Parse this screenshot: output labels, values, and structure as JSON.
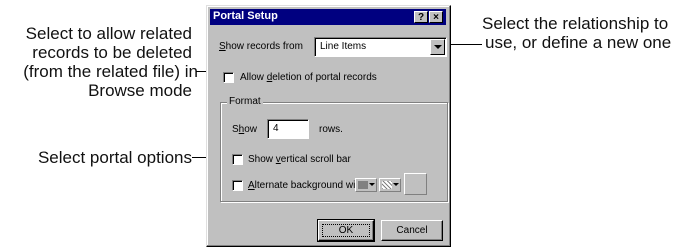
{
  "callouts": {
    "left_top": [
      "Select to allow related",
      "records to be deleted",
      "(from the related file) in",
      "Browse mode"
    ],
    "left_mid": "Select portal options",
    "right": [
      "Select the relationship to",
      "use, or define a new one"
    ]
  },
  "dialog": {
    "title": "Portal Setup",
    "help_label": "?",
    "close_label": "×",
    "show_records_label_pre": "",
    "show_records_label_u": "S",
    "show_records_label_post": "how records from",
    "show_records_value": "Line Items",
    "allow_delete_pre": "Allow ",
    "allow_delete_u": "d",
    "allow_delete_post": "eletion of portal records",
    "format_legend": "Format",
    "show_pre": "S",
    "show_u": "h",
    "show_post": "ow",
    "rows_value": "4",
    "rows_label": "rows.",
    "scroll_pre": "Show ",
    "scroll_u": "v",
    "scroll_post": "ertical scroll bar",
    "alt_pre": "",
    "alt_u": "A",
    "alt_post": "lternate background with",
    "ok_label": "OK",
    "cancel_label": "Cancel"
  },
  "colors": {
    "title_bar": "#000080",
    "dialog_face": "#c0c0c0",
    "swatch_color": "#808080"
  }
}
